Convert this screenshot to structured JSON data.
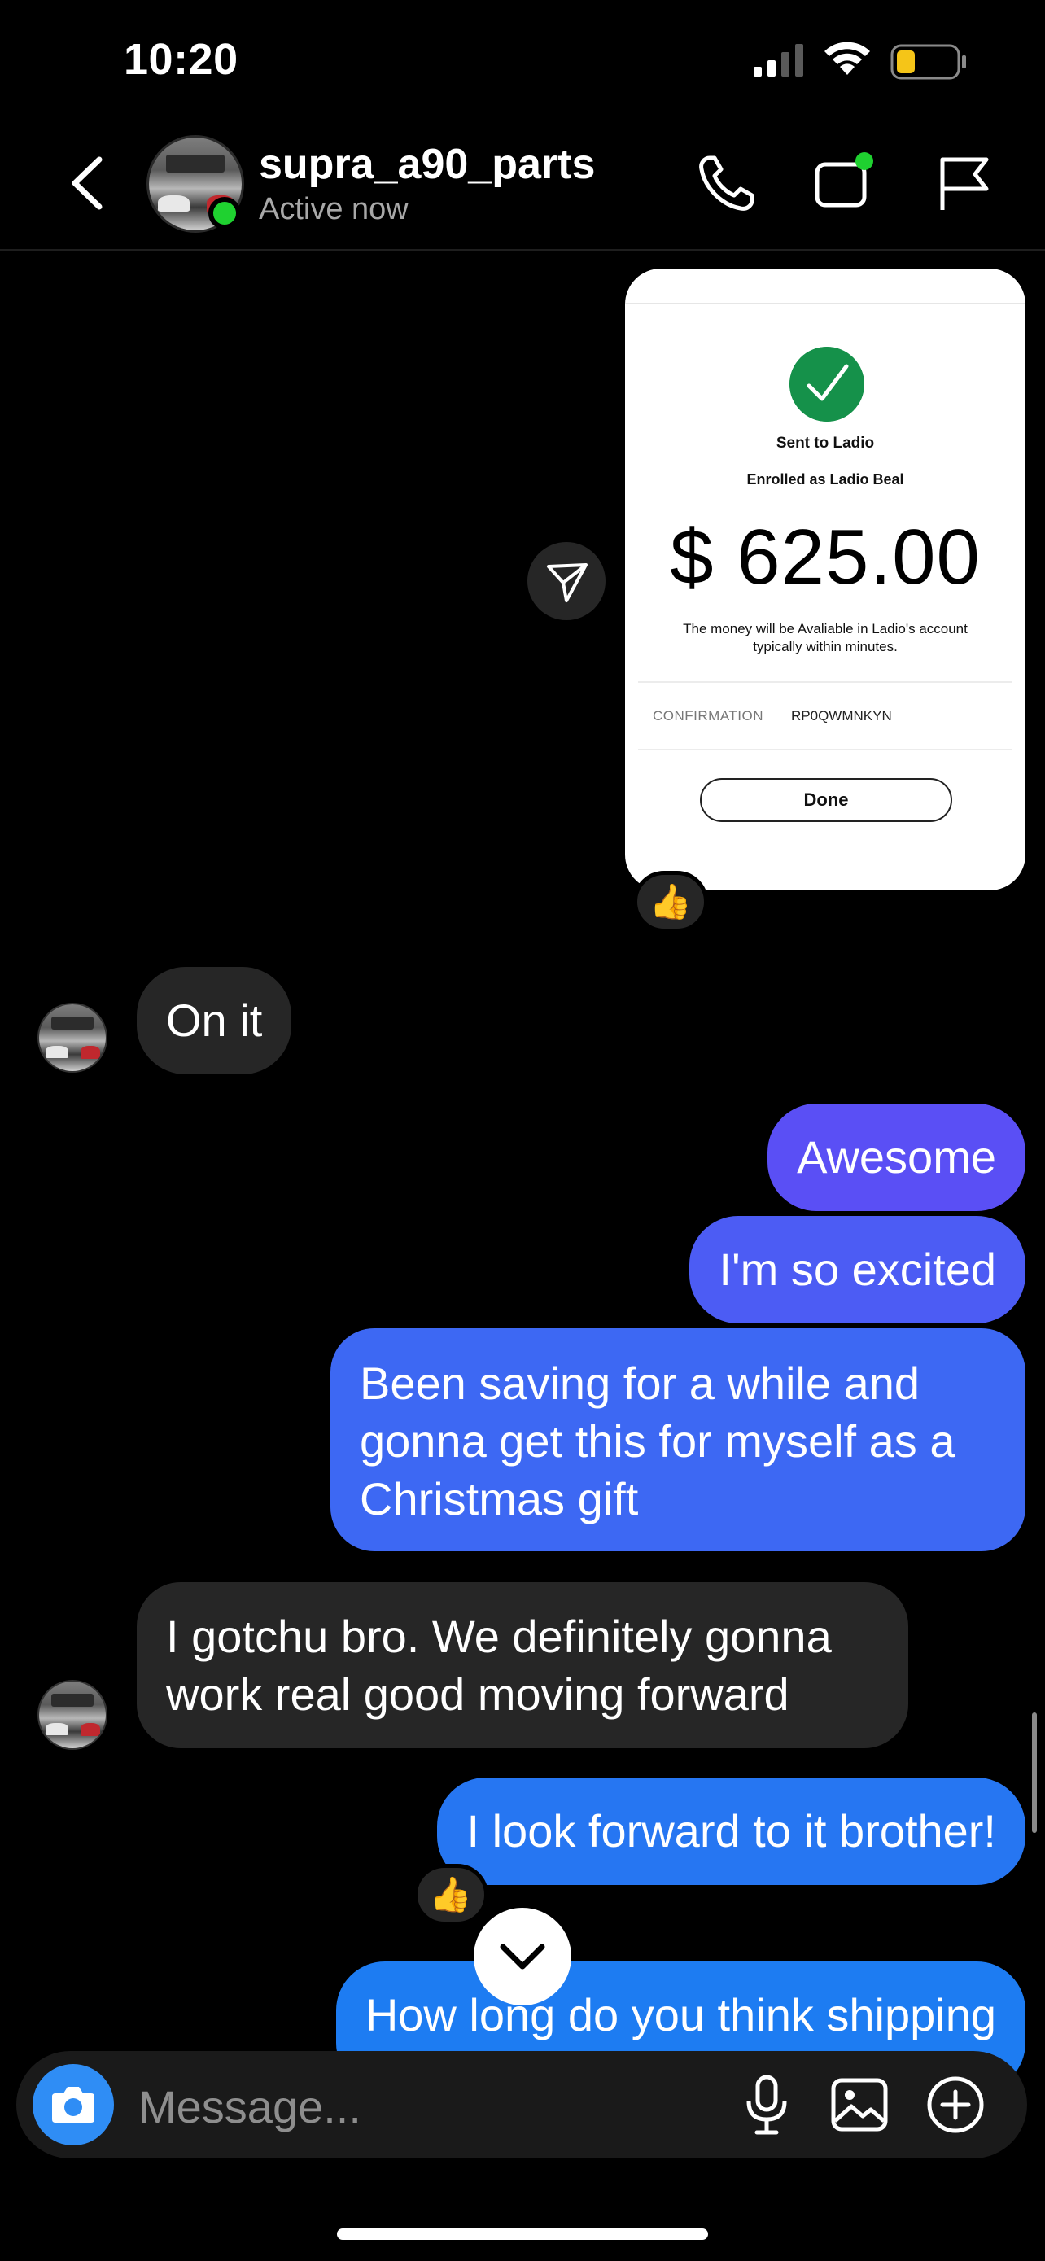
{
  "status_bar": {
    "time": "10:20"
  },
  "header": {
    "username": "supra_a90_parts",
    "status": "Active now",
    "icons": [
      "back-icon",
      "phone-icon",
      "video-icon",
      "flag-icon"
    ]
  },
  "payment_card": {
    "sent_to": "Sent to Ladio",
    "enrolled": "Enrolled as Ladio Beal",
    "amount": "$ 625.00",
    "note": "The money will be Avaliable in Ladio's account typically within minutes.",
    "confirmation_label": "CONFIRMATION",
    "confirmation_value": "RP0QWMNKYN",
    "done_label": "Done",
    "reaction": "👍"
  },
  "messages": [
    {
      "from": "them",
      "text": "On it"
    },
    {
      "from": "me",
      "text": "Awesome"
    },
    {
      "from": "me",
      "text": "I'm so excited"
    },
    {
      "from": "me",
      "lines": [
        "Been saving for a while and",
        "gonna get this for myself as a",
        "Christmas gift"
      ]
    },
    {
      "from": "them",
      "lines": [
        "I gotchu bro. We definitely gonna",
        "work real good moving forward"
      ]
    },
    {
      "from": "me",
      "text": "I look forward to it brother!",
      "reaction": "👍"
    },
    {
      "from": "me",
      "text": "How long do you think shipping"
    }
  ],
  "composer": {
    "placeholder": "Message..."
  },
  "colors": {
    "outgoing_top": "#5a4ff5",
    "outgoing_bottom": "#1d7cf2",
    "incoming": "#262626",
    "online": "#1fd130"
  }
}
